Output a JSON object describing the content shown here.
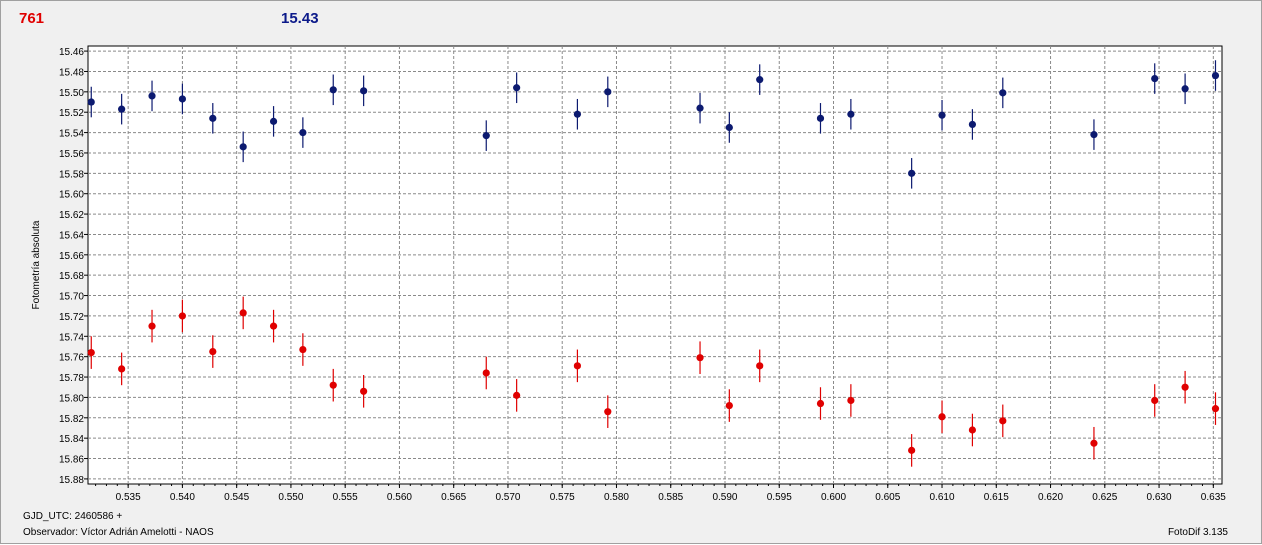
{
  "header": {
    "left_value": "761",
    "right_value": "15.43",
    "left_color": "#e00000",
    "right_color": "#0c1a8a"
  },
  "footer": {
    "gjd": "GJD_UTC: 2460586 +",
    "observer": "Observador: Víctor Adrián Amelotti - NAOS",
    "version": "FotoDif 3.135"
  },
  "chart_data": {
    "type": "scatter",
    "ylabel": "Fotometría absoluta",
    "xlabel": "",
    "xlim": [
      0.5313,
      0.6358
    ],
    "ylim": [
      15.885,
      15.455
    ],
    "y_inverted": true,
    "grid": true,
    "x_ticks": [
      "0.535",
      "0.540",
      "0.545",
      "0.550",
      "0.555",
      "0.560",
      "0.565",
      "0.570",
      "0.575",
      "0.580",
      "0.585",
      "0.590",
      "0.595",
      "0.600",
      "0.605",
      "0.610",
      "0.615",
      "0.620",
      "0.625",
      "0.630",
      "0.635"
    ],
    "y_ticks": [
      "15.46",
      "15.48",
      "15.50",
      "15.52",
      "15.54",
      "15.56",
      "15.58",
      "15.60",
      "15.62",
      "15.64",
      "15.66",
      "15.68",
      "15.70",
      "15.72",
      "15.74",
      "15.76",
      "15.78",
      "15.80",
      "15.82",
      "15.84",
      "15.86",
      "15.88"
    ],
    "series": [
      {
        "color": "#0c1a70",
        "error": 0.015,
        "points": [
          [
            0.5316,
            15.51
          ],
          [
            0.5344,
            15.517
          ],
          [
            0.5372,
            15.504
          ],
          [
            0.54,
            15.507
          ],
          [
            0.5428,
            15.526
          ],
          [
            0.5456,
            15.554
          ],
          [
            0.5484,
            15.529
          ],
          [
            0.5511,
            15.54
          ],
          [
            0.5539,
            15.498
          ],
          [
            0.5567,
            15.499
          ],
          [
            0.568,
            15.543
          ],
          [
            0.5708,
            15.496
          ],
          [
            0.5764,
            15.522
          ],
          [
            0.5792,
            15.5
          ],
          [
            0.5877,
            15.516
          ],
          [
            0.5904,
            15.535
          ],
          [
            0.5932,
            15.488
          ],
          [
            0.5988,
            15.526
          ],
          [
            0.6016,
            15.522
          ],
          [
            0.6072,
            15.58
          ],
          [
            0.61,
            15.523
          ],
          [
            0.6128,
            15.532
          ],
          [
            0.6156,
            15.501
          ],
          [
            0.624,
            15.542
          ],
          [
            0.6296,
            15.487
          ],
          [
            0.6324,
            15.497
          ],
          [
            0.6352,
            15.484
          ]
        ]
      },
      {
        "color": "#e00000",
        "error": 0.016,
        "points": [
          [
            0.5316,
            15.756
          ],
          [
            0.5344,
            15.772
          ],
          [
            0.5372,
            15.73
          ],
          [
            0.54,
            15.72
          ],
          [
            0.5428,
            15.755
          ],
          [
            0.5456,
            15.717
          ],
          [
            0.5484,
            15.73
          ],
          [
            0.5511,
            15.753
          ],
          [
            0.5539,
            15.788
          ],
          [
            0.5567,
            15.794
          ],
          [
            0.568,
            15.776
          ],
          [
            0.5708,
            15.798
          ],
          [
            0.5764,
            15.769
          ],
          [
            0.5792,
            15.814
          ],
          [
            0.5877,
            15.761
          ],
          [
            0.5904,
            15.808
          ],
          [
            0.5932,
            15.769
          ],
          [
            0.5988,
            15.806
          ],
          [
            0.6016,
            15.803
          ],
          [
            0.6072,
            15.852
          ],
          [
            0.61,
            15.819
          ],
          [
            0.6128,
            15.832
          ],
          [
            0.6156,
            15.823
          ],
          [
            0.624,
            15.845
          ],
          [
            0.6296,
            15.803
          ],
          [
            0.6324,
            15.79
          ],
          [
            0.6352,
            15.811
          ]
        ]
      }
    ]
  }
}
